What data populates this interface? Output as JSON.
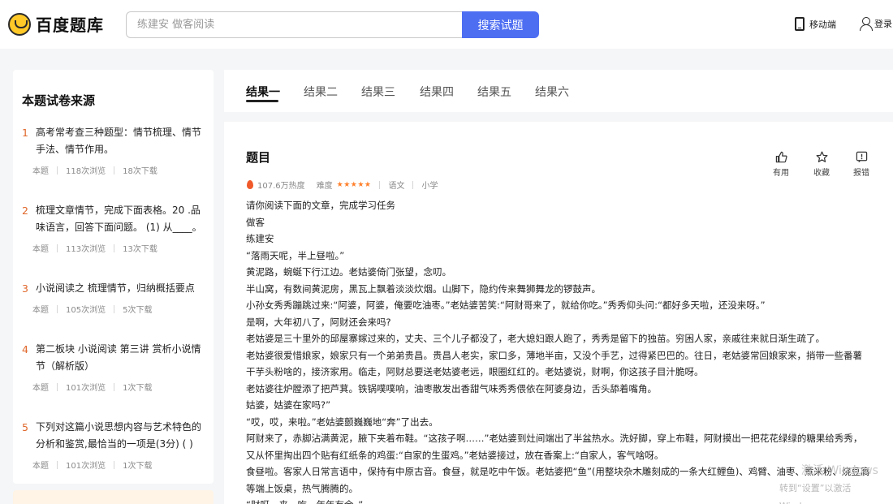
{
  "header": {
    "logo_text": "百度题库",
    "search_placeholder": "练建安 做客阅读",
    "search_button": "搜索试题",
    "mobile_label": "移动端",
    "login_label": "登录"
  },
  "sidebar": {
    "title": "本题试卷来源",
    "items": [
      {
        "num": "1",
        "title": "高考常考查三种题型：情节梳理、情节手法、情节作用。",
        "tag": "本题",
        "views": "118次浏览",
        "downloads": "18次下载"
      },
      {
        "num": "2",
        "title": "梳理文章情节，完成下面表格。20 .品味语言，回答下面问题。 (1) 从____。",
        "tag": "本题",
        "views": "113次浏览",
        "downloads": "13次下载"
      },
      {
        "num": "3",
        "title": "小说阅读之 梳理情节，归纳概括要点",
        "tag": "本题",
        "views": "105次浏览",
        "downloads": "5次下载"
      },
      {
        "num": "4",
        "title": "第二板块 小说阅读 第三讲 赏析小说情节（解析版）",
        "tag": "本题",
        "views": "101次浏览",
        "downloads": "1次下载"
      },
      {
        "num": "5",
        "title": "下列对这篇小说思想内容与艺术特色的分析和鉴赏,最恰当的一项是(3分) ( )",
        "tag": "本题",
        "views": "101次浏览",
        "downloads": "1次下载"
      }
    ]
  },
  "tabs": [
    "结果一",
    "结果二",
    "结果三",
    "结果四",
    "结果五",
    "结果六"
  ],
  "question": {
    "title": "题目",
    "heat": "107.6万热度",
    "difficulty_label": "难度",
    "stars": "★★★★★",
    "subject": "语文",
    "level": "小学",
    "actions": {
      "useful": "有用",
      "favorite": "收藏",
      "report": "报错"
    },
    "body": [
      "请你阅读下面的文章，完成学习任务",
      "做客",
      "练建安",
      "“落雨天呢，半上昼啦。”",
      "黄泥路，蜿蜒下行江边。老姑婆倚门张望，念叨。",
      "半山窝，有数间黄泥房，黑瓦上飘着淡淡炊烟。山脚下，隐约传来舞狮舞龙的锣鼓声。",
      "小孙女秀秀蹦跳过来:“阿婆，阿婆，俺要吃油枣。”老姑婆苦笑:“阿财哥来了，就给你吃。”秀秀仰头问:“都好多天啦，还没来呀。”",
      "是啊，大年初八了，阿财还会来吗?",
      "老姑婆是三十里外的邱屋寨嫁过来的，丈夫、三个儿子都没了，老大媳妇跟人跑了，秀秀是留下的独苗。穷困人家，亲戚往来就日渐生疏了。",
      "老姑婆很爱惜娘家，娘家只有一个弟弟贵昌。贵昌人老实，家口多，薄地半亩，又没个手艺，过得紧巴巴的。往日，老姑婆常回娘家来，捎带一些番薯干芋头粉啥的，接济家用。临走，阿财总要送老姑婆老远，眼圈红红的。老姑婆说，财啊，你这孩子目汁脆呀。",
      "老姑婆往炉膛添了把芦萁。铁锅噗噗响，油枣散发出香甜气味秀秀偎依在阿婆身边，舌头舔着嘴角。",
      "姑婆，姑婆在家吗?”",
      "“哎，哎，来啦。”老姑婆颤巍巍地“奔”了出去。",
      "阿财来了，赤脚沾满黄泥，腋下夹着布鞋。“这孩子啊……”老姑婆到灶间端出了半盆热水。洗好脚，穿上布鞋，阿财摸出一把花花绿绿的糖果给秀秀，又从怀里掏出四个贴有红纸条的鸡蛋:“自家的生蛋鸡。”老姑婆接过，放在香案上:“自家人，客气啥呀。",
      "食昼啦。客家人日常言语中，保持有中原古音。食昼，就是吃中午饭。老姑婆把“鱼”(用整块杂木雕刻成的一条大红鲤鱼)、鸡臂、油枣、煮米粉、烧豆腐等端上饭桌，热气腾腾的。",
      "“财呀，来，吃，年年有余。”"
    ]
  },
  "watermark": {
    "line1": "激活 Windows",
    "line2": "转到“设置”以激活 Windows。"
  }
}
